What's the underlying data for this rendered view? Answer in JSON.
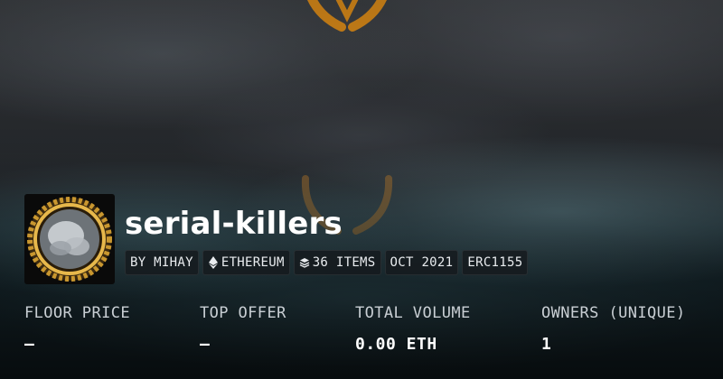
{
  "collection": {
    "title": "serial-killers",
    "meta": {
      "creator": "BY MIHAY",
      "chain": "ETHEREUM",
      "items": "36 ITEMS",
      "date": "OCT 2021",
      "standard": "ERC1155"
    }
  },
  "stats": [
    {
      "label": "FLOOR PRICE",
      "value": "—"
    },
    {
      "label": "TOP OFFER",
      "value": "—"
    },
    {
      "label": "TOTAL VOLUME",
      "value": "0.00 ETH"
    },
    {
      "label": "OWNERS (UNIQUE)",
      "value": "1"
    }
  ],
  "icons": {
    "chain": "ethereum-icon",
    "items": "layers-icon",
    "avatar": "gold-medallion-avatar",
    "banner": "orange-emblem-icon"
  },
  "colors": {
    "accent": "#d98a1a",
    "text": "#ffffff",
    "muted": "#c9cfd4"
  }
}
